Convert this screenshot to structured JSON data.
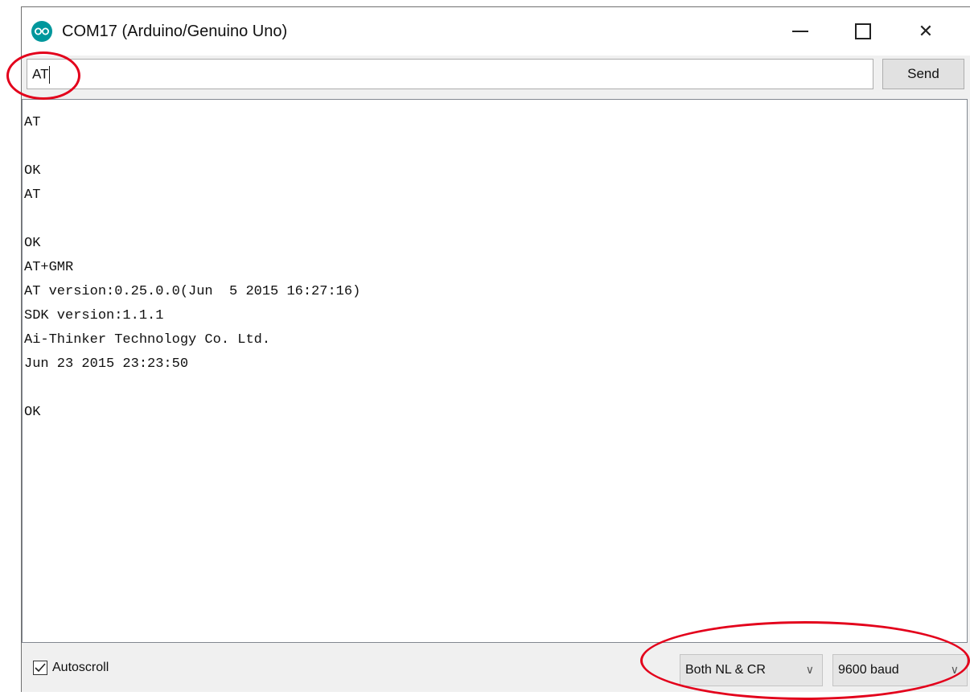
{
  "window": {
    "title": "COM17 (Arduino/Genuino Uno)",
    "icon": "arduino-logo-icon",
    "controls": [
      "minimize-icon",
      "maximize-icon",
      "close-icon"
    ]
  },
  "input": {
    "value": "AT",
    "send_label": "Send"
  },
  "output": {
    "lines": [
      "AT",
      "",
      "OK",
      "AT",
      "",
      "OK",
      "AT+GMR",
      "AT version:0.25.0.0(Jun  5 2015 16:27:16)",
      "SDK version:1.1.1",
      "Ai-Thinker Technology Co. Ltd.",
      "Jun 23 2015 23:23:50",
      "",
      "OK"
    ]
  },
  "statusbar": {
    "autoscroll_label": "Autoscroll",
    "autoscroll_checked": true,
    "line_ending": "Both NL & CR",
    "baud_rate": "9600 baud"
  },
  "colors": {
    "annotation": "#e3001b",
    "arduino_teal": "#00979c"
  }
}
